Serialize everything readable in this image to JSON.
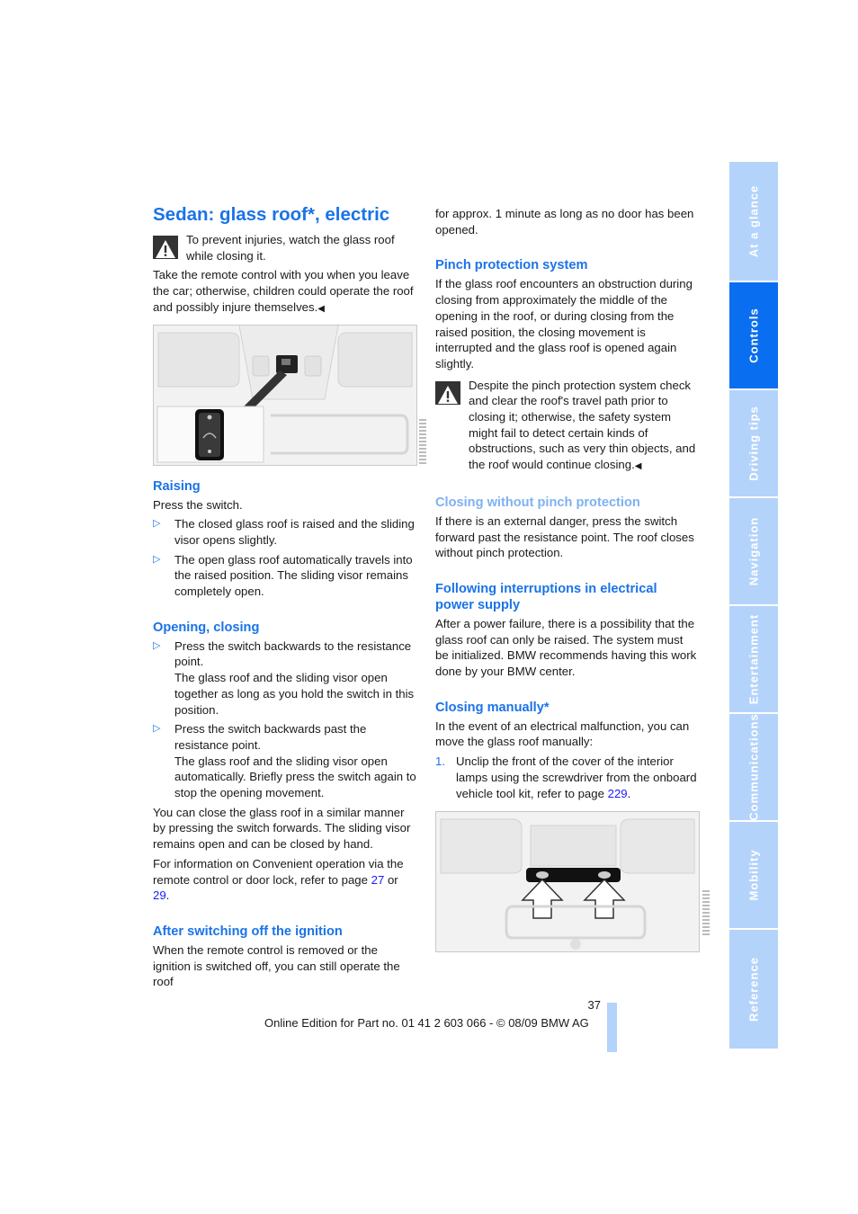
{
  "page": {
    "number": "37",
    "footer": "Online Edition for Part no. 01 41 2 603 066 - © 08/09 BMW AG"
  },
  "side_tabs": [
    {
      "label": "At a glance",
      "active": false
    },
    {
      "label": "Controls",
      "active": true
    },
    {
      "label": "Driving tips",
      "active": false
    },
    {
      "label": "Navigation",
      "active": false
    },
    {
      "label": "Entertainment",
      "active": false
    },
    {
      "label": "Communications",
      "active": false
    },
    {
      "label": "Mobility",
      "active": false
    },
    {
      "label": "Reference",
      "active": false
    }
  ],
  "left": {
    "title": "Sedan: glass roof*, electric",
    "warning1": "To prevent injuries, watch the glass roof while closing it.",
    "warning1_cont": "Take the remote control with you when you leave the car; otherwise, children could operate the roof and possibly injure themselves.",
    "end_mark": "◀",
    "figure1_alt": "Glass roof switch in the headliner with enlarged switch detail",
    "raising": {
      "heading": "Raising",
      "intro": "Press the switch.",
      "bullets": [
        "The closed glass roof is raised and the sliding visor opens slightly.",
        "The open glass roof automatically travels into the raised position. The sliding visor remains completely open."
      ]
    },
    "opening": {
      "heading": "Opening, closing",
      "bullets": [
        {
          "line1": "Press the switch backwards to the resistance point.",
          "line2": "The glass roof and the sliding visor open together as long as you hold the switch in this position."
        },
        {
          "line1": "Press the switch backwards past the resistance point.",
          "line2": "The glass roof and the sliding visor open automatically. Briefly press the switch again to stop the opening movement."
        }
      ],
      "para1": "You can close the glass roof in a similar manner by pressing the switch forwards. The sliding visor remains open and can be closed by hand.",
      "para2_pre": "For information on Convenient operation via the remote control or door lock, refer to page ",
      "para2_link1": "27",
      "para2_mid": " or ",
      "para2_link2": "29",
      "para2_end": "."
    },
    "after_ignition": {
      "heading": "After switching off the ignition",
      "text": "When the remote control is removed or the ignition is switched off, you can still operate the roof"
    }
  },
  "right": {
    "cont_text": "for approx. 1 minute as long as no door has been opened.",
    "pinch": {
      "heading": "Pinch protection system",
      "text": "If the glass roof encounters an obstruction during closing from approximately the middle of the opening in the roof, or during closing from the raised position, the closing movement is interrupted and the glass roof is opened again slightly.",
      "warning": "Despite the pinch protection system check and clear the roof's travel path prior to closing it; otherwise, the safety system might fail to detect certain kinds of obstructions, such as very thin objects, and the roof would continue closing."
    },
    "without_pinch": {
      "heading": "Closing without pinch protection",
      "text": "If there is an external danger, press the switch forward past the resistance point. The roof closes without pinch protection."
    },
    "interruptions": {
      "heading": "Following interruptions in electrical power supply",
      "text": "After a power failure, there is a possibility that the glass roof can only be raised. The system must be initialized. BMW recommends having this work done by your BMW center."
    },
    "manual": {
      "heading": "Closing manually*",
      "intro": "In the event of an electrical malfunction, you can move the glass roof manually:",
      "steps": [
        {
          "num": "1.",
          "text_pre": "Unclip the front of the cover of the interior lamps using the screwdriver from the onboard vehicle tool kit, refer to page ",
          "link": "229",
          "text_end": "."
        }
      ]
    },
    "figure2_alt": "Interior lamp cover with arrows indicating unclip points"
  }
}
